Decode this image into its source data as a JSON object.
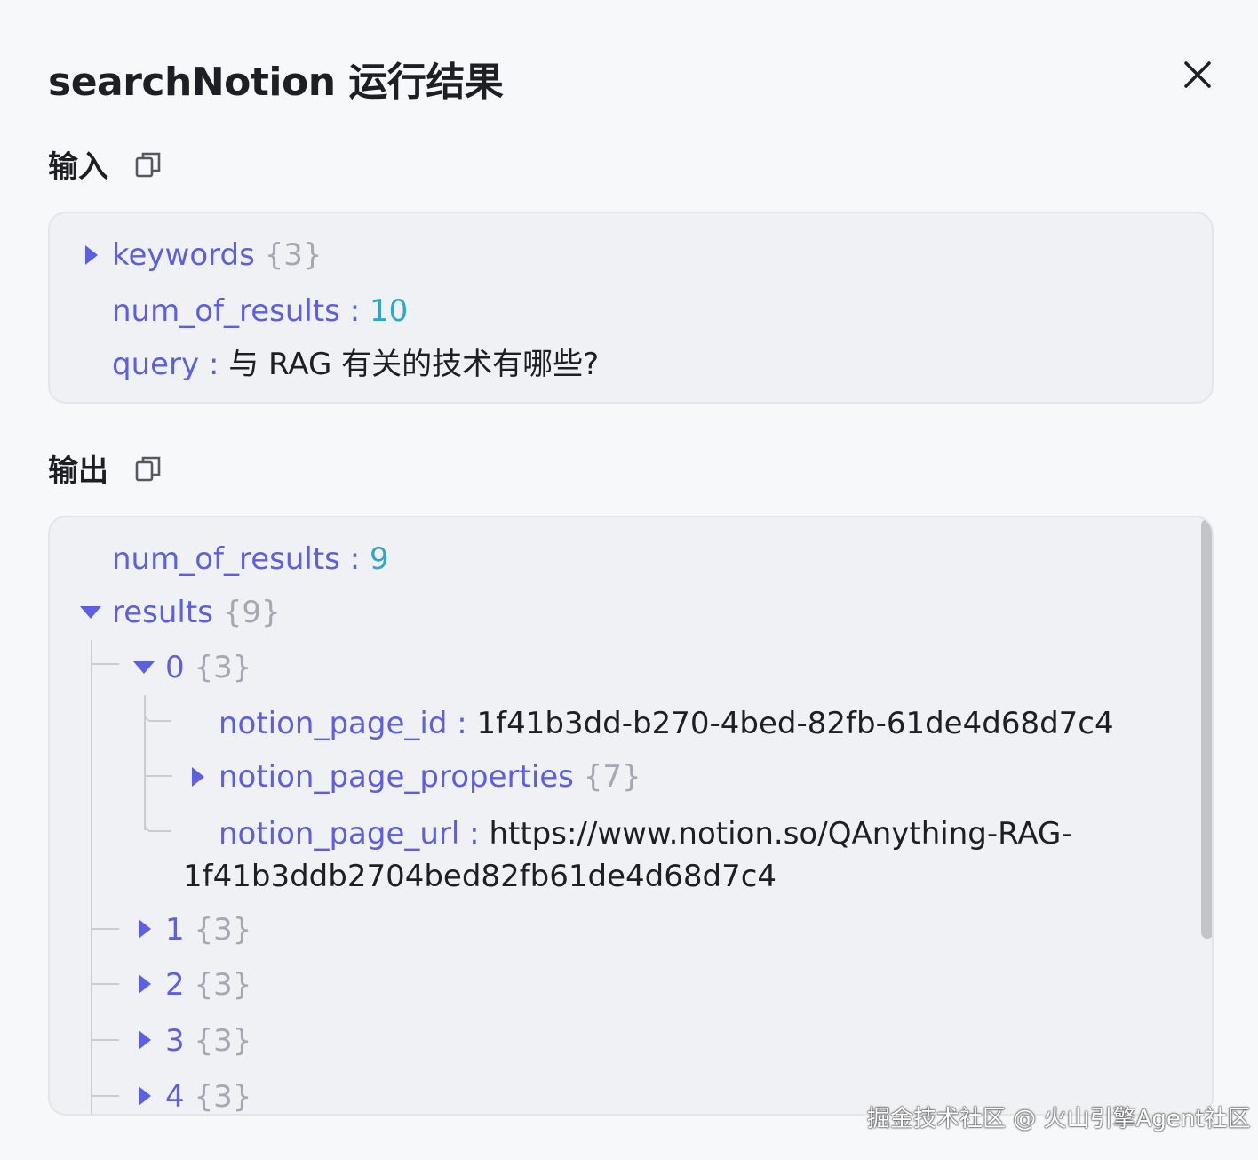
{
  "dialog": {
    "title": "searchNotion 运行结果"
  },
  "input": {
    "heading": "输入",
    "fields": {
      "keywords_key": "keywords",
      "keywords_count": "{3}",
      "num_key": "num_of_results",
      "num_sep": " : ",
      "num_value": "10",
      "query_key": "query",
      "query_sep": " : ",
      "query_value": "与 RAG 有关的技术有哪些?"
    }
  },
  "output": {
    "heading": "输出",
    "num_key": "num_of_results",
    "num_sep": " : ",
    "num_value": "9",
    "results_key": "results",
    "results_count": "{9}",
    "item0": {
      "key": "0",
      "count": "{3}",
      "page_id_key": "notion_page_id",
      "page_id_sep": " : ",
      "page_id_value": "1f41b3dd-b270-4bed-82fb-61de4d68d7c4",
      "props_key": "notion_page_properties",
      "props_count": "{7}",
      "url_key": "notion_page_url",
      "url_sep": " : ",
      "url_value_line1": "https://www.notion.so/QAnything-RAG-",
      "url_value_line2": "1f41b3ddb2704bed82fb61de4d68d7c4"
    },
    "collapsed_items": [
      {
        "key": "1",
        "count": "{3}"
      },
      {
        "key": "2",
        "count": "{3}"
      },
      {
        "key": "3",
        "count": "{3}"
      },
      {
        "key": "4",
        "count": "{3}"
      }
    ]
  },
  "watermark": "掘金技术社区 @ 火山引擎Agent社区",
  "icons": {
    "close": "close-icon",
    "copy": "copy-icon",
    "expand": "caret-right-icon",
    "collapse": "caret-down-icon"
  },
  "colors": {
    "key": "#5b5fe0",
    "number": "#30a7c9",
    "count": "#a4a8b2",
    "panel_bg": "#f0f1f4"
  }
}
